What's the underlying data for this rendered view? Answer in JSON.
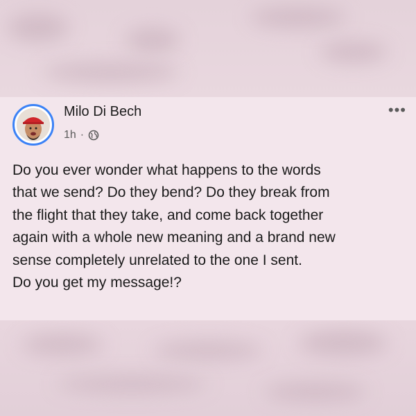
{
  "post": {
    "author_name": "Milo Di Bech",
    "timestamp": "1h",
    "separator": "·",
    "audience_icon": "globe-icon",
    "more_icon": "more-options-icon",
    "more_glyph": "•••",
    "text_lines": [
      "Do you ever wonder what happens to the words",
      "that we send? Do they bend? Do they break from",
      "the flight that they take, and come back together",
      "again with a whole new meaning and a brand new",
      "sense completely unrelated to the one I sent.",
      "Do you get my message!?"
    ]
  },
  "colors": {
    "avatar_ring": "#3b82f6",
    "card_background": "#f3e6ec",
    "page_background": "#ead9e0"
  }
}
